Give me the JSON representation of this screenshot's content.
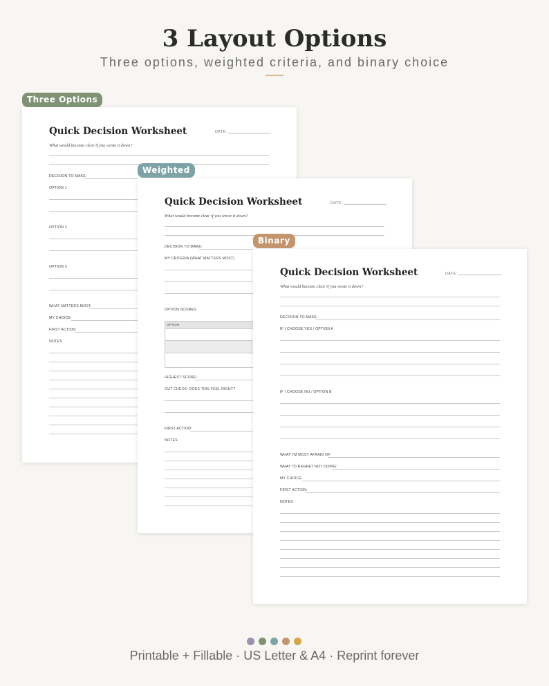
{
  "header": {
    "title": "3 Layout Options",
    "subtitle": "Three options, weighted criteria, and binary choice"
  },
  "colors": {
    "three_options": "#7f9274",
    "weighted": "#7ea3a6",
    "binary": "#c4956c"
  },
  "worksheet": {
    "title": "Quick Decision Worksheet",
    "subtitle": "What would become clear if you wrote it down?",
    "date_label": "DATE:"
  },
  "pages": {
    "three": {
      "tag": "Three Options",
      "decision": "DECISION TO MAKE:",
      "option1": "OPTION 1",
      "option2": "OPTION 2",
      "option3": "OPTION 3",
      "matters": "WHAT MATTERS MOST:",
      "choice": "MY CHOICE:",
      "first_action": "FIRST ACTION:",
      "notes": "NOTES"
    },
    "weighted": {
      "tag": "Weighted",
      "decision": "DECISION TO MAKE:",
      "criteria": "MY CRITERIA (WHAT MATTERS MOST)",
      "scores": "OPTION SCORES",
      "table_header": "OPTION",
      "highest": "HIGHEST SCORE:",
      "gut": "GUT CHECK: DOES THIS FEEL RIGHT?",
      "first_action": "FIRST ACTION:",
      "notes": "NOTES"
    },
    "binary": {
      "tag": "Binary",
      "decision": "DECISION TO MAKE:",
      "yes": "IF I CHOOSE YES / OPTION A",
      "no": "IF I CHOOSE NO / OPTION B",
      "afraid": "WHAT I'M MOST AFRAID OF:",
      "regret": "WHAT I'D REGRET NOT DOING:",
      "choice": "MY CHOICE:",
      "first_action": "FIRST ACTION:",
      "notes": "NOTES"
    }
  },
  "palette_dots": [
    "#9d90ad",
    "#7f9274",
    "#7ea3a6",
    "#c4956c",
    "#d4a843"
  ],
  "footer": "Printable + Fillable · US Letter & A4 · Reprint forever"
}
